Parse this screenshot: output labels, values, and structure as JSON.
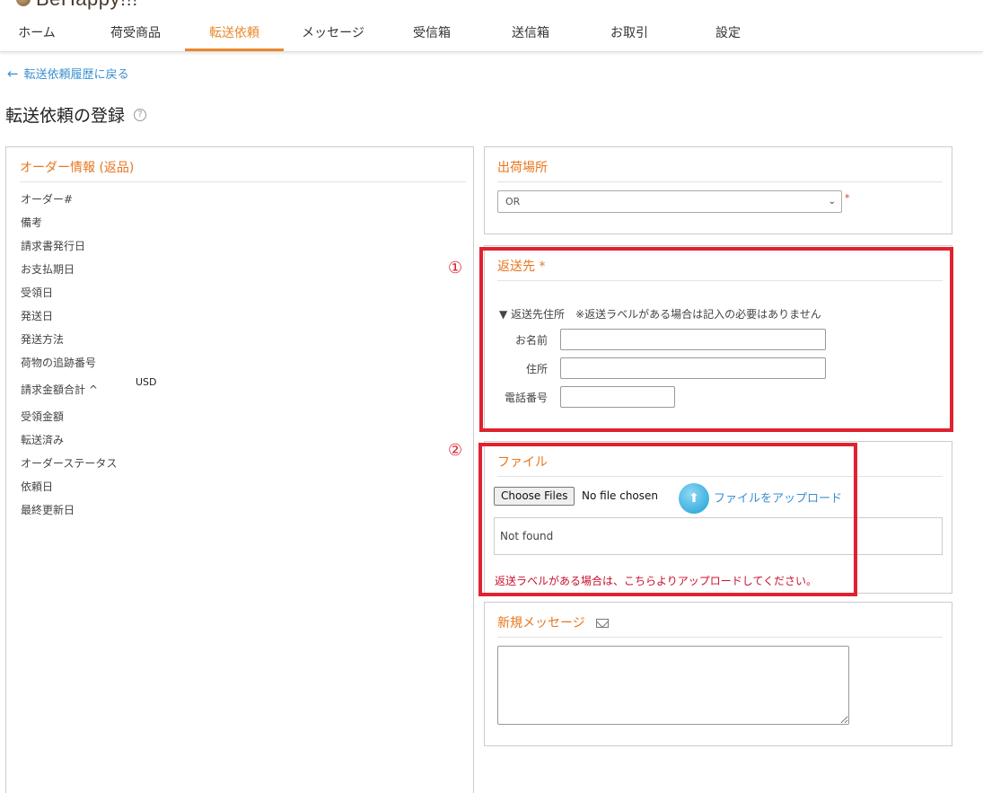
{
  "logo": {
    "text": "BeHappy!!!"
  },
  "nav": {
    "items": [
      {
        "label": "ホーム"
      },
      {
        "label": "荷受商品"
      },
      {
        "label": "転送依頼"
      },
      {
        "label": "メッセージ"
      },
      {
        "label": "受信箱"
      },
      {
        "label": "送信箱"
      },
      {
        "label": "お取引"
      },
      {
        "label": "設定"
      }
    ],
    "active_index": 2
  },
  "back_link": {
    "label": "転送依頼履歴に戻る"
  },
  "page": {
    "title": "転送依頼の登録"
  },
  "order_info": {
    "title": "オーダー情報 (返品)",
    "fields": [
      {
        "label": "オーダー#"
      },
      {
        "label": "備考"
      },
      {
        "label": "請求書発行日"
      },
      {
        "label": "お支払期日"
      },
      {
        "label": "受領日"
      },
      {
        "label": "発送日"
      },
      {
        "label": "発送方法"
      },
      {
        "label": "荷物の追跡番号"
      },
      {
        "label": "請求金額合計 ^",
        "currency": "USD"
      },
      {
        "label": "受領金額"
      },
      {
        "label": "転送済み"
      },
      {
        "label": "オーダーステータス"
      },
      {
        "label": "依頼日"
      },
      {
        "label": "最終更新日"
      }
    ]
  },
  "ship_from": {
    "title": "出荷場所",
    "selected": "OR",
    "required_mark": "*"
  },
  "return_dest": {
    "title": "返送先",
    "required_mark": "*",
    "heading": "▼ 返送先住所　※返送ラベルがある場合は記入の必要はありません",
    "name_label": "お名前",
    "address_label": "住所",
    "phone_label": "電話番号",
    "name_value": "",
    "address_value": "",
    "phone_value": ""
  },
  "file": {
    "title": "ファイル",
    "choose_label": "Choose Files",
    "no_file_text": "No file chosen",
    "upload_label": "ファイルをアップロード",
    "empty_text": "Not found",
    "note": "返送ラベルがある場合は、こちらよりアップロードしてください。"
  },
  "message": {
    "title": "新規メッセージ",
    "value": ""
  },
  "annotations": {
    "marker_1": "①",
    "marker_2": "②",
    "frame_color": "#e0222e"
  },
  "colors": {
    "accent": "#e8761e",
    "link": "#3a8fd0",
    "note_red": "#c8102e"
  }
}
